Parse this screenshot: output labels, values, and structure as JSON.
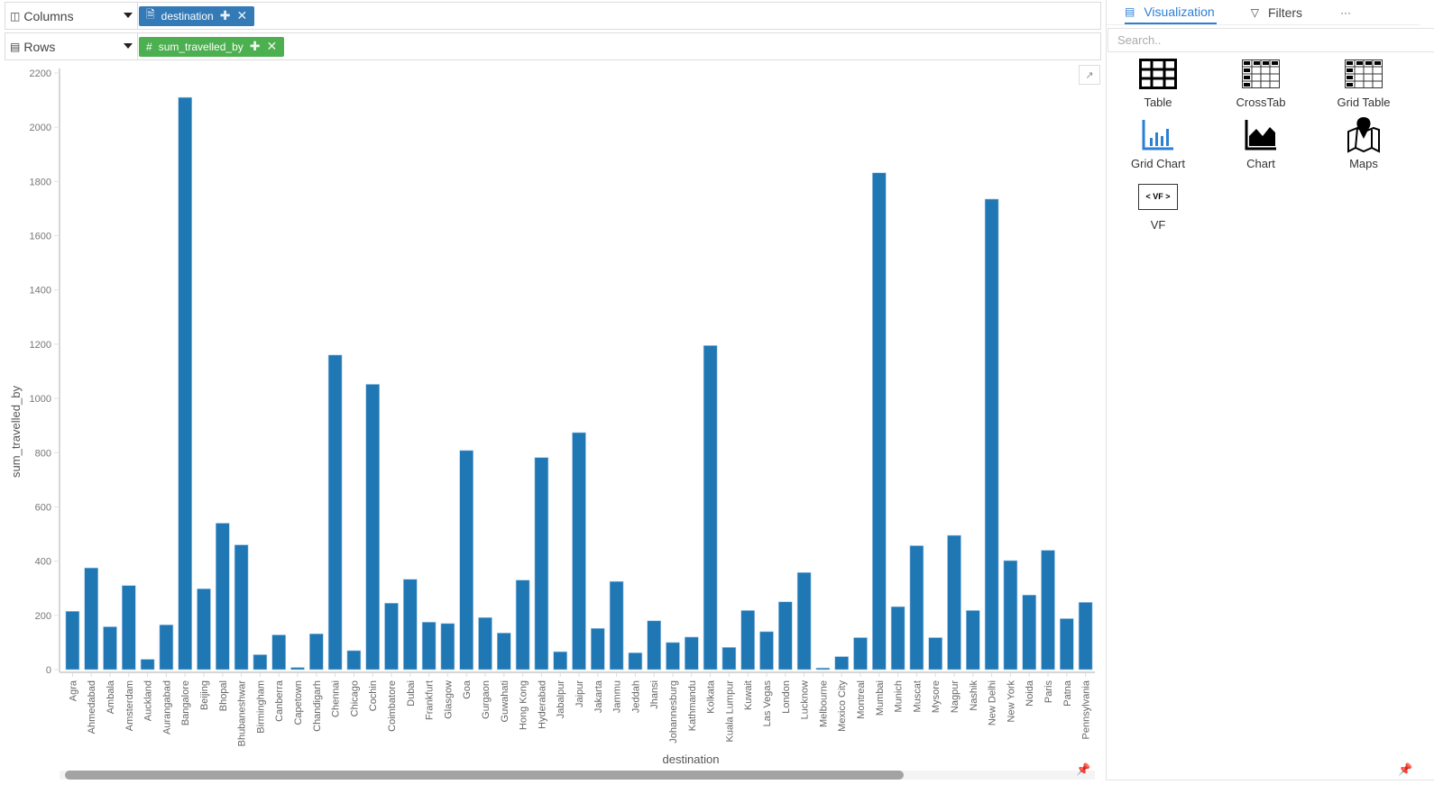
{
  "shelves": {
    "columns": {
      "label": "Columns",
      "icon": "columns-icon",
      "pill": {
        "label": "destination",
        "icon": "document-icon",
        "color": "#337ab7"
      }
    },
    "rows": {
      "label": "Rows",
      "icon": "rows-icon",
      "pill": {
        "label": "sum_travelled_by",
        "icon": "hash-icon",
        "color": "#4caf50"
      }
    }
  },
  "sidebar": {
    "tabs": [
      {
        "label": "Visualization",
        "icon": "area-chart-icon",
        "active": true
      },
      {
        "label": "Filters",
        "icon": "filter-icon",
        "active": false
      },
      {
        "label": "···",
        "icon": "more-icon",
        "active": false
      }
    ],
    "search_placeholder": "Search..",
    "items": [
      {
        "label": "Table",
        "icon": "table-icon"
      },
      {
        "label": "CrossTab",
        "icon": "crosstab-icon"
      },
      {
        "label": "Grid Table",
        "icon": "grid-table-icon"
      },
      {
        "label": "Grid Chart",
        "icon": "grid-chart-icon"
      },
      {
        "label": "Chart",
        "icon": "chart-icon"
      },
      {
        "label": "Maps",
        "icon": "maps-icon"
      },
      {
        "label": "VF",
        "icon": "vf-icon",
        "badge": "< VF >"
      }
    ]
  },
  "chart_data": {
    "type": "bar",
    "title": "",
    "xlabel": "destination",
    "ylabel": "sum_travelled_by",
    "ylim": [
      0,
      2200
    ],
    "yticks": [
      0,
      200,
      400,
      600,
      800,
      1000,
      1200,
      1400,
      1600,
      1800,
      2000,
      2200
    ],
    "grid": false,
    "bar_color": "#1f77b4",
    "categories": [
      "Agra",
      "Ahmedabad",
      "Ambala",
      "Amsterdam",
      "Auckland",
      "Aurangabad",
      "Bangalore",
      "Beijing",
      "Bhopal",
      "Bhubaneshwar",
      "Birmingham",
      "Canberra",
      "Capetown",
      "Chandigarh",
      "Chennai",
      "Chicago",
      "Cochin",
      "Coimbatore",
      "Dubai",
      "Frankfurt",
      "Glasgow",
      "Goa",
      "Gurgaon",
      "Guwahati",
      "Hong Kong",
      "Hyderabad",
      "Jabalpur",
      "Jaipur",
      "Jakarta",
      "Jammu",
      "Jeddah",
      "Jhansi",
      "Johannesburg",
      "Kathmandu",
      "Kolkata",
      "Kuala Lumpur",
      "Kuwait",
      "Las Vegas",
      "London",
      "Lucknow",
      "Melbourne",
      "Mexico City",
      "Montreal",
      "Mumbai",
      "Munich",
      "Muscat",
      "Mysore",
      "Nagpur",
      "Nashik",
      "New Delhi",
      "New York",
      "Noida",
      "Paris",
      "Patna",
      "Pennsylvania"
    ],
    "values": [
      215,
      375,
      158,
      310,
      38,
      165,
      2110,
      298,
      540,
      460,
      55,
      128,
      8,
      132,
      1160,
      70,
      1052,
      245,
      333,
      175,
      170,
      808,
      192,
      135,
      330,
      782,
      66,
      874,
      152,
      325,
      62,
      180,
      100,
      120,
      1195,
      82,
      218,
      140,
      250,
      358,
      6,
      48,
      118,
      1832,
      232,
      457,
      118,
      495,
      218,
      1735,
      402,
      275,
      440,
      188,
      248
    ]
  },
  "chart_controls": {
    "trend_icon": "trend-line-icon"
  }
}
